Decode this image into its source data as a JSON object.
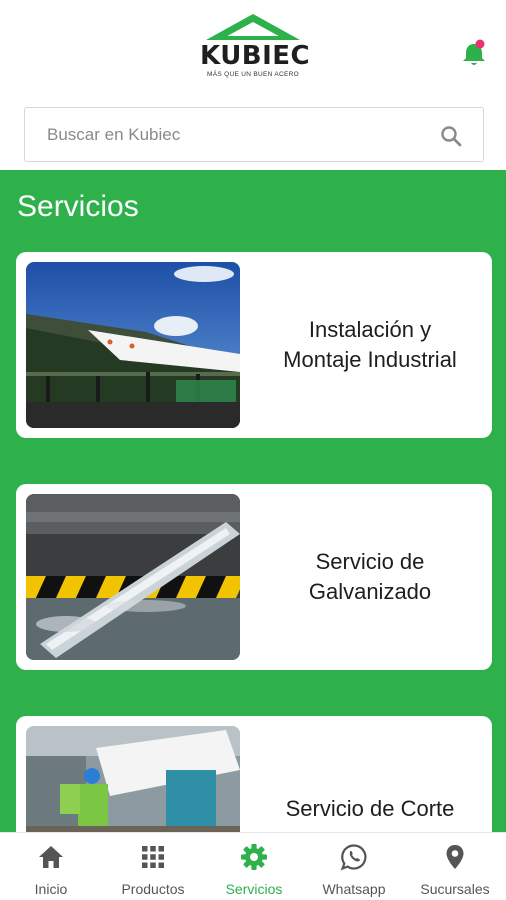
{
  "header": {
    "logo_text": "KUBIEC",
    "logo_tagline": "MÁS QUE UN BUEN ACERO"
  },
  "search": {
    "placeholder": "Buscar en Kubiec"
  },
  "main": {
    "section_title": "Servicios",
    "services": [
      {
        "line1": "Instalación y",
        "line2": "Montaje Industrial",
        "image": "industrial-roof-installation-photo"
      },
      {
        "line1": "Servicio de",
        "line2": "Galvanizado",
        "image": "galvanizing-bath-photo"
      },
      {
        "line1": "Servicio de Corte",
        "line2": "",
        "image": "steel-cutting-workshop-photo"
      }
    ]
  },
  "bottom_nav": {
    "items": [
      {
        "label": "Inicio",
        "icon": "home-icon"
      },
      {
        "label": "Productos",
        "icon": "grid-icon"
      },
      {
        "label": "Servicios",
        "icon": "gear-icon",
        "active": true
      },
      {
        "label": "Whatsapp",
        "icon": "whatsapp-icon"
      },
      {
        "label": "Sucursales",
        "icon": "location-pin-icon"
      }
    ]
  },
  "colors": {
    "brand_green": "#2eb14a",
    "notification_dot": "#e8336d",
    "inactive_nav": "#555555"
  }
}
